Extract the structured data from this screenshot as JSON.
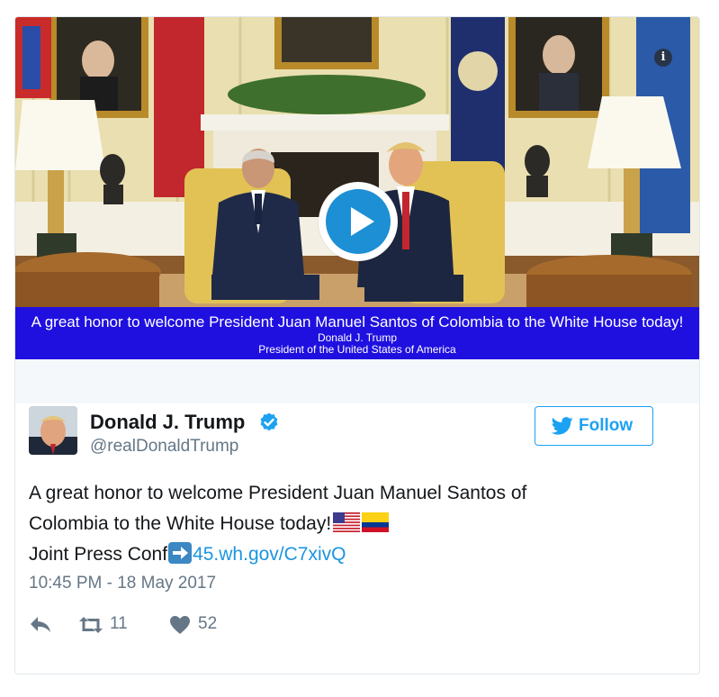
{
  "media": {
    "caption_line1": "A great honor to welcome President Juan Manuel Santos of Colombia to the White House today!",
    "caption_line2": "Donald J. Trump",
    "caption_line3": "President of the United States of America",
    "info_icon": "info-icon",
    "play_icon": "play-icon",
    "caption_background": "#1f10e0"
  },
  "author": {
    "display_name": "Donald J. Trump",
    "handle": "@realDonaldTrump",
    "verified": true,
    "verified_icon": "verified-badge-icon"
  },
  "follow_button": {
    "label": "Follow",
    "icon": "twitter-bird-icon",
    "color": "#1da1f2"
  },
  "tweet": {
    "text_line1": "A great honor to welcome President Juan Manuel Santos of",
    "text_line2": "Colombia to the White House today!",
    "text_line3_prefix": "Joint Press Conf",
    "link_text": "45.wh.gov/C7xivQ",
    "link_color": "#1b95e0",
    "emojis": [
      "us-flag",
      "colombia-flag",
      "right-arrow"
    ]
  },
  "timestamp": "10:45 PM - 18 May 2017",
  "actions": {
    "reply_icon": "reply-icon",
    "retweet_icon": "retweet-icon",
    "retweet_count": "11",
    "like_icon": "heart-icon",
    "like_count": "52"
  }
}
